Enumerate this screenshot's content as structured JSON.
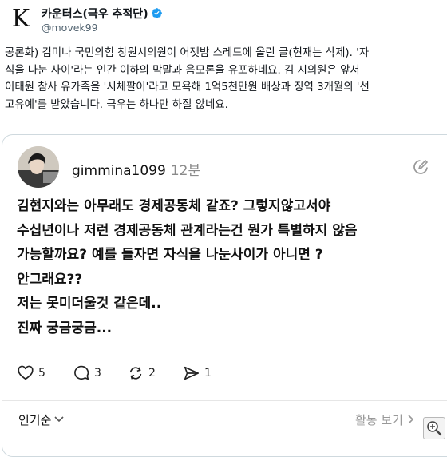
{
  "account": {
    "logo_letter": "K",
    "display_name": "카운터스(극우 추적단)",
    "handle": "@movek99"
  },
  "post": {
    "lines": [
      "공론화) 김미나 국민의힘 창원시의원이 어젯밤 스레드에 올린 글(현재는 삭제). '자",
      "식을 나눈 사이'라는 인간 이하의 막말과 음모론을 유포하네요. 김 시의원은 앞서",
      "이태원 참사 유가족을 '시체팔이'라고 모욕해 1억5천만원 배상과 징역 3개월의 '선",
      "고유예'를 받았습니다. 극우는 하나만 하질 않네요."
    ]
  },
  "embedded": {
    "username": "gimmina1099",
    "time": "12분",
    "lines": [
      "김현지와는 아무래도 경제공동체 같죠? 그렇지않고서야",
      "수십년이나  저런 경제공동체 관계라는건 뭔가 특별하지 않음",
      "가능할까요? 예를 들자면 자식을 나눈사이가 아니면 ?",
      "안그래요??",
      "저는 못미더울것 같은데..",
      "진짜 궁금궁금..."
    ],
    "actions": {
      "likes": "5",
      "comments": "3",
      "reposts": "2",
      "shares": "1"
    },
    "sort_label": "인기순",
    "activity_label": "활동 보기"
  },
  "colors": {
    "verified": "#1d9bf0",
    "text": "#0f1419",
    "muted": "#536471"
  },
  "icons": [
    "verified-badge-icon",
    "edit-icon",
    "heart-icon",
    "comment-icon",
    "repost-icon",
    "share-icon",
    "chevron-down-icon",
    "chevron-right-icon",
    "zoom-icon"
  ]
}
